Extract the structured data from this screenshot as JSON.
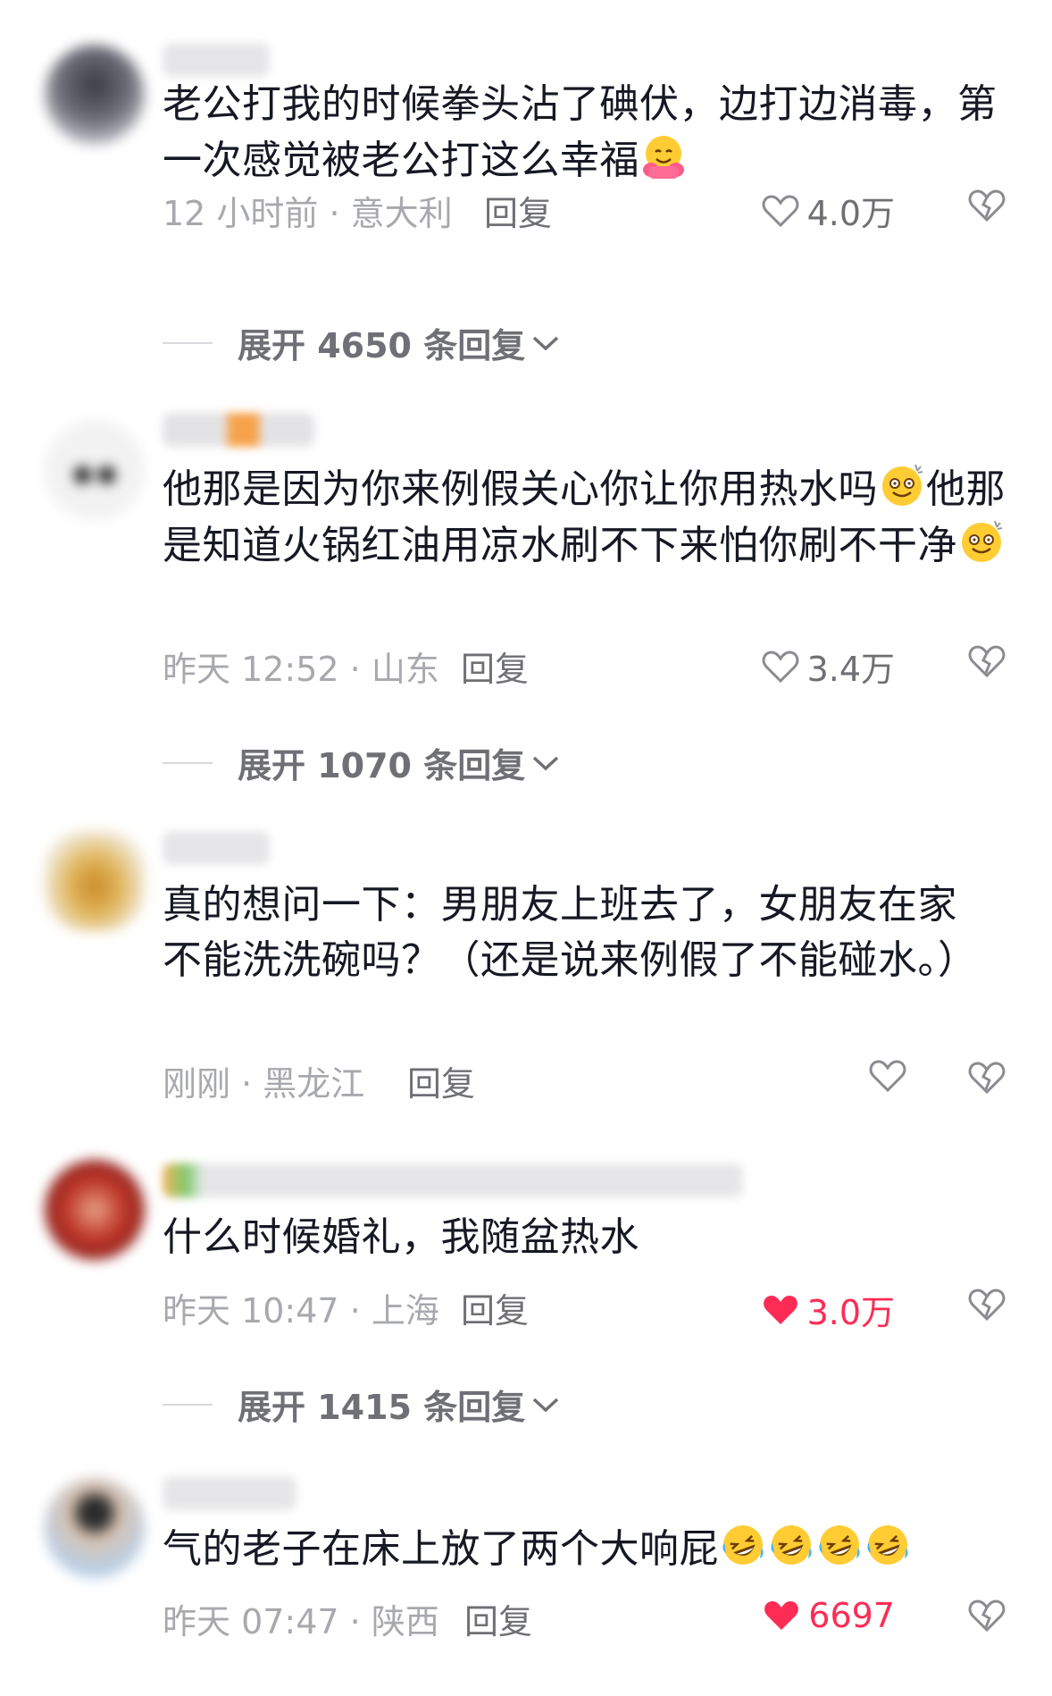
{
  "comments": [
    {
      "text": "老公打我的时候拳头沾了碘伏，边打边消毒，第一次感觉被老公打这么幸福",
      "emoji": "hugging-face",
      "meta": "12 小时前 · 意大利",
      "reply_label": "回复",
      "likes": "4.0万",
      "liked": false,
      "expand": "展开 4650 条回复"
    },
    {
      "text_a": "他那是因为你来例假关心你让你用热水吗",
      "emoji": "dizzy-smile",
      "text_b": "他那是知道火锅红油用凉水刷不下来怕你刷不干净",
      "meta": "昨天 12:52 · 山东",
      "reply_label": "回复",
      "likes": "3.4万",
      "liked": false,
      "expand": "展开 1070 条回复"
    },
    {
      "text": "真的想问一下：男朋友上班去了，女朋友在家不能洗洗碗吗？（还是说来例假了不能碰水。）",
      "meta": "刚刚 · 黑龙江",
      "reply_label": "回复",
      "likes": "",
      "liked": false
    },
    {
      "text": "什么时候婚礼，我随盆热水",
      "meta": "昨天 10:47 · 上海",
      "reply_label": "回复",
      "likes": "3.0万",
      "liked": true,
      "expand": "展开 1415 条回复"
    },
    {
      "text": "气的老子在床上放了两个大响屁",
      "emoji": "rolling-on-floor-laughing",
      "emoji_count": 4,
      "meta": "昨天 07:47 · 陕西",
      "reply_label": "回复",
      "likes": "6697",
      "liked": true
    }
  ],
  "colors": {
    "text": "#161823",
    "meta": "#a8a9ae",
    "secondary": "#6f7075",
    "liked": "#fe2c55"
  }
}
